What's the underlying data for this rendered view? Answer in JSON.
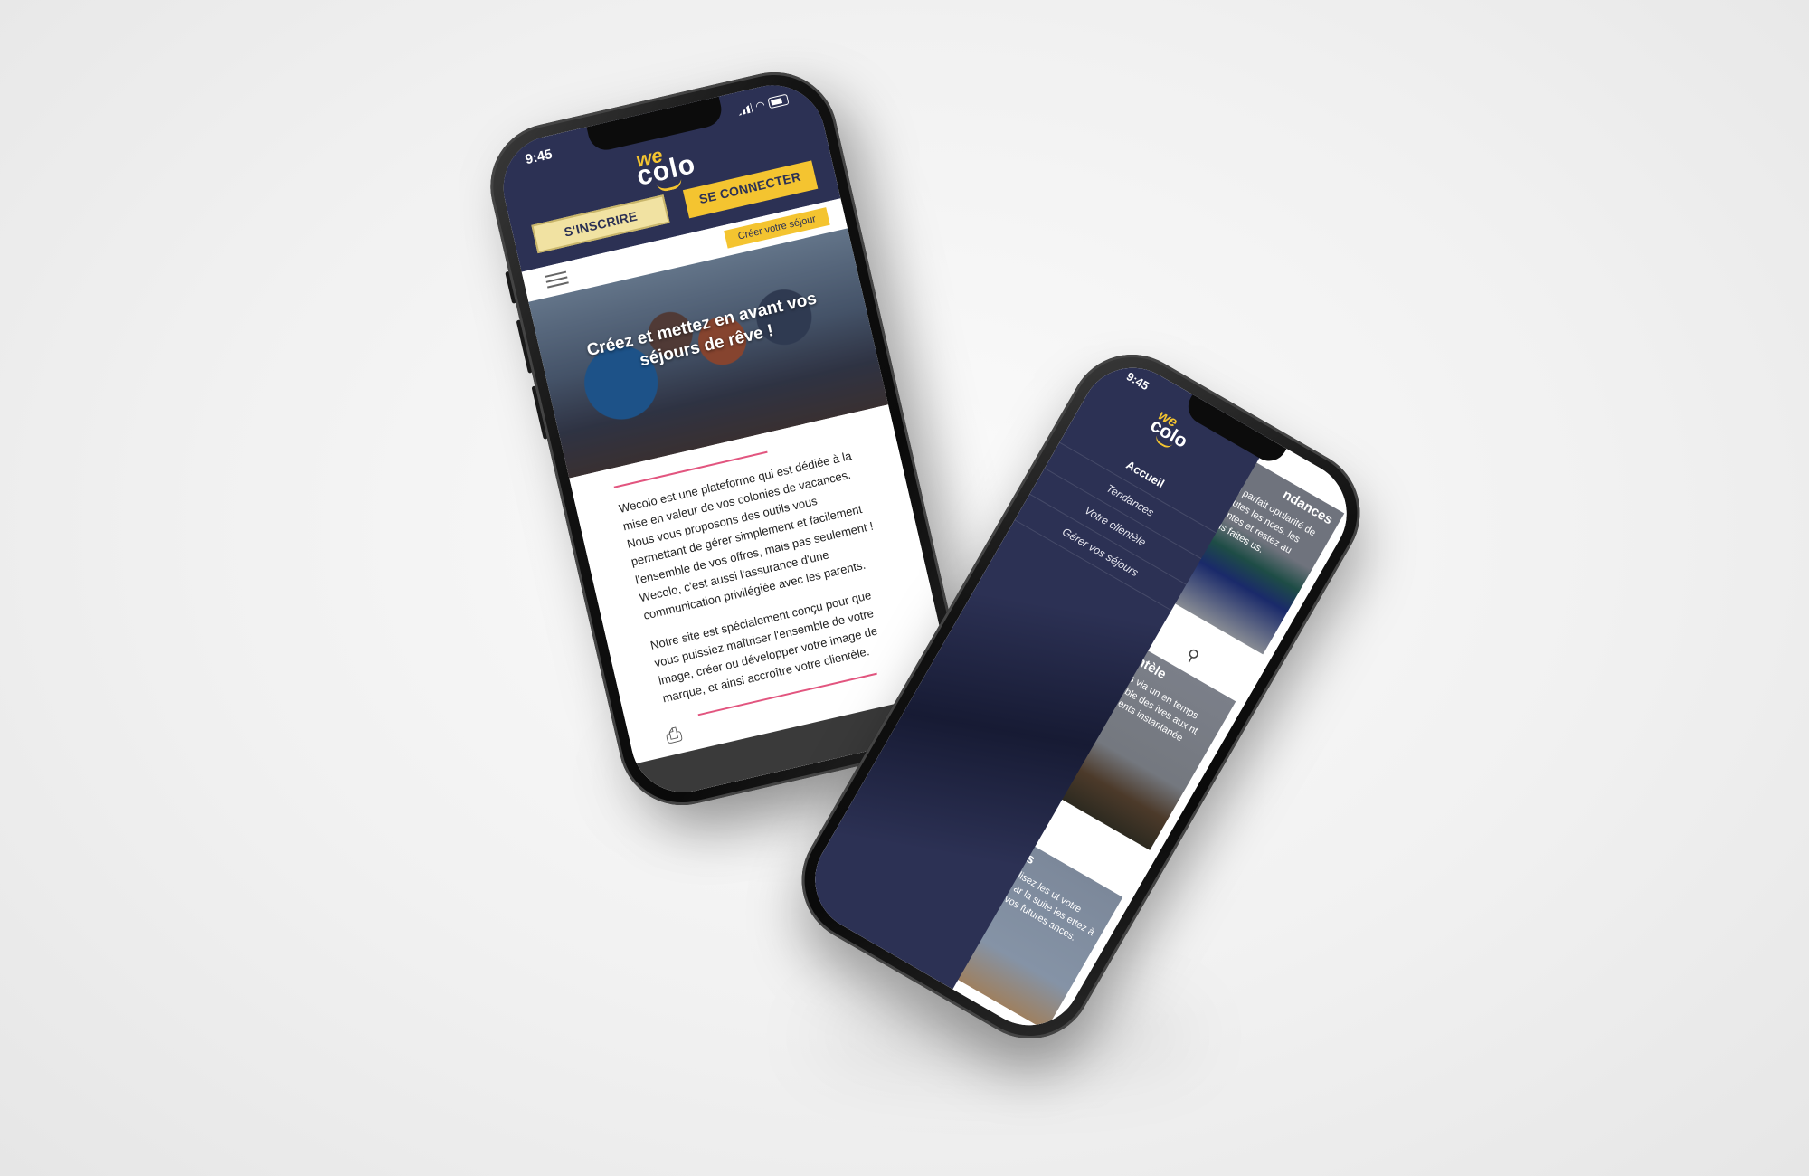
{
  "phone1": {
    "status_time": "9:45",
    "logo": {
      "top": "we",
      "bottom": "colo"
    },
    "buttons": {
      "signup": "S'INSCRIRE",
      "login": "SE CONNECTER"
    },
    "nav": {
      "cta": "Créer votre séjour"
    },
    "hero_title": "Créez et mettez en avant vos séjours de rêve !",
    "paragraph1": "Wecolo est une plateforme qui est dédiée à la mise en valeur de vos colonies de vacances. Nous vous proposons des outils vous permettant de gérer simplement et facilement l'ensemble de vos offres, mais pas seulement ! Wecolo, c'est aussi l'assurance d'une communication privilégiée avec les parents.",
    "paragraph2": "Notre site est spécialement conçu pour que vous puissiez maîtriser l'ensemble de votre image, créer ou développer votre image de marque, et ainsi accroître votre clientèle."
  },
  "phone2": {
    "status_time": "9:45",
    "logo": {
      "top": "we",
      "bottom": "colo"
    },
    "menu": [
      "Accueil",
      "Tendances",
      "Votre clientèle",
      "Gérer vos séjours"
    ],
    "card1": {
      "title": "ndances",
      "text": ": l'outil parfait opularité de vos toutes les nces. les différentes et restez au ositions faites us."
    },
    "card2": {
      "title": "clientèle",
      "text": "ervées via un en temps réel mble des ives aux nt vos clients instantanée"
    },
    "card3": {
      "title": "jours",
      "text": "sonnalisez les ut votre image ar la suite les ettez à jour z vos futures ances."
    }
  },
  "colors": {
    "navy": "#2c3154",
    "yellow": "#f4c430",
    "pink": "#e2557f"
  }
}
